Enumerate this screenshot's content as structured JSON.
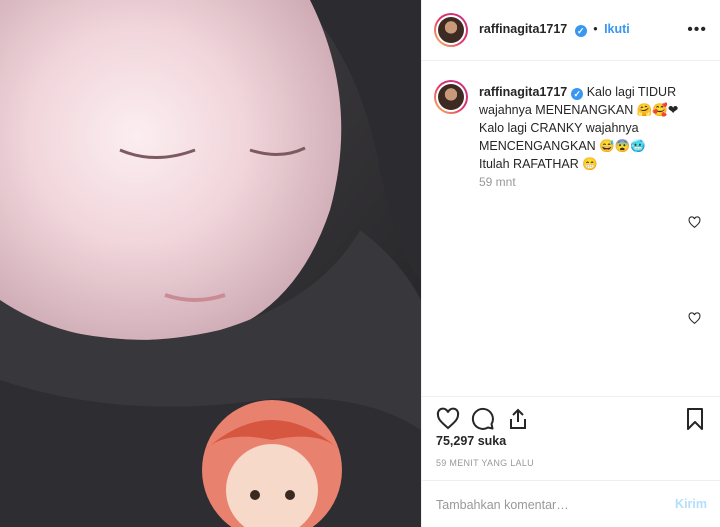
{
  "post": {
    "username": "raffinagita1717",
    "verified_mark": "✓",
    "follow_separator": "•",
    "follow_label": "Ikuti",
    "more_label": "•••"
  },
  "caption": {
    "username": "raffinagita1717",
    "lines": [
      "Kalo lagi TIDUR",
      "wajahnya MENENANGKAN 🤗🥰❤",
      "Kalo lagi CRANKY wajahnya",
      "MENCENGANGKAN 😅😨🥶",
      "Itulah RAFATHAR 😁"
    ],
    "time": "59 mnt"
  },
  "actions": {
    "likes": "75,297 suka",
    "time_ago": "59 MENIT YANG LALU"
  },
  "comment": {
    "placeholder": "Tambahkan komentar…",
    "send_label": "Kirim"
  },
  "icons": [
    "heart-icon",
    "comment-icon",
    "share-icon",
    "bookmark-icon",
    "more-icon",
    "verified-icon"
  ],
  "colors": {
    "link": "#3897f0",
    "muted": "#999999",
    "send_disabled": "#b2dffc"
  }
}
